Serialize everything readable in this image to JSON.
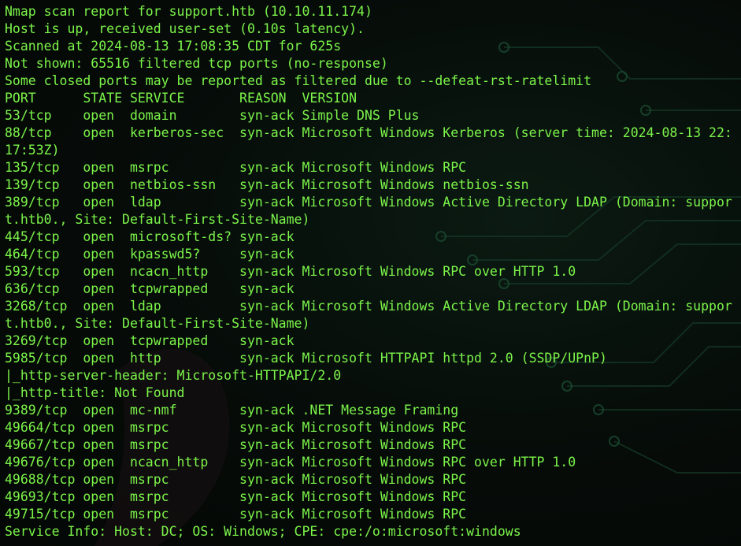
{
  "terminal": {
    "colors": {
      "text": "#7cf54a",
      "background": "#050906"
    },
    "lines": [
      "Nmap scan report for support.htb (10.10.11.174)",
      "Host is up, received user-set (0.10s latency).",
      "Scanned at 2024-08-13 17:08:35 CDT for 625s",
      "Not shown: 65516 filtered tcp ports (no-response)",
      "Some closed ports may be reported as filtered due to --defeat-rst-ratelimit",
      "PORT      STATE SERVICE       REASON  VERSION",
      "53/tcp    open  domain        syn-ack Simple DNS Plus",
      "88/tcp    open  kerberos-sec  syn-ack Microsoft Windows Kerberos (server time: 2024-08-13 22:",
      "17:53Z)",
      "135/tcp   open  msrpc         syn-ack Microsoft Windows RPC",
      "139/tcp   open  netbios-ssn   syn-ack Microsoft Windows netbios-ssn",
      "389/tcp   open  ldap          syn-ack Microsoft Windows Active Directory LDAP (Domain: suppor",
      "t.htb0., Site: Default-First-Site-Name)",
      "445/tcp   open  microsoft-ds? syn-ack",
      "464/tcp   open  kpasswd5?     syn-ack",
      "593/tcp   open  ncacn_http    syn-ack Microsoft Windows RPC over HTTP 1.0",
      "636/tcp   open  tcpwrapped    syn-ack",
      "3268/tcp  open  ldap          syn-ack Microsoft Windows Active Directory LDAP (Domain: suppor",
      "t.htb0., Site: Default-First-Site-Name)",
      "3269/tcp  open  tcpwrapped    syn-ack",
      "5985/tcp  open  http          syn-ack Microsoft HTTPAPI httpd 2.0 (SSDP/UPnP)",
      "|_http-server-header: Microsoft-HTTPAPI/2.0",
      "|_http-title: Not Found",
      "9389/tcp  open  mc-nmf        syn-ack .NET Message Framing",
      "49664/tcp open  msrpc         syn-ack Microsoft Windows RPC",
      "49667/tcp open  msrpc         syn-ack Microsoft Windows RPC",
      "49676/tcp open  ncacn_http    syn-ack Microsoft Windows RPC over HTTP 1.0",
      "49688/tcp open  msrpc         syn-ack Microsoft Windows RPC",
      "49693/tcp open  msrpc         syn-ack Microsoft Windows RPC",
      "49715/tcp open  msrpc         syn-ack Microsoft Windows RPC",
      "Service Info: Host: DC; OS: Windows; CPE: cpe:/o:microsoft:windows"
    ]
  }
}
